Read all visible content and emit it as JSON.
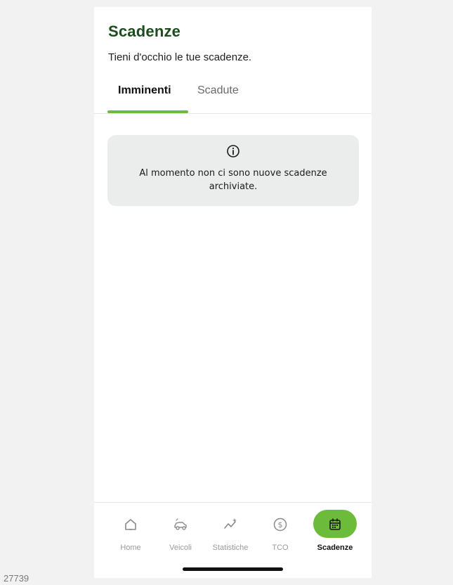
{
  "header": {
    "title": "Scadenze",
    "subtitle": "Tieni d'occhio le tue scadenze."
  },
  "tabs": [
    {
      "label": "Imminenti",
      "active": true
    },
    {
      "label": "Scadute",
      "active": false
    }
  ],
  "info_card": {
    "icon": "info-icon",
    "message": "Al momento non ci sono nuove scadenze archiviate."
  },
  "bottom_nav": {
    "items": [
      {
        "label": "Home",
        "icon": "home-icon",
        "active": false
      },
      {
        "label": "Veicoli",
        "icon": "car-icon",
        "active": false
      },
      {
        "label": "Statistiche",
        "icon": "sparkline-icon",
        "active": false
      },
      {
        "label": "TCO",
        "icon": "dollar-icon",
        "active": false
      },
      {
        "label": "Scadenze",
        "icon": "calendar-icon",
        "active": true
      }
    ]
  },
  "colors": {
    "accent": "#6dbb3a",
    "title": "#1d4d1d",
    "card_bg": "#ebeded"
  },
  "footer": {
    "image_number": "27739"
  }
}
